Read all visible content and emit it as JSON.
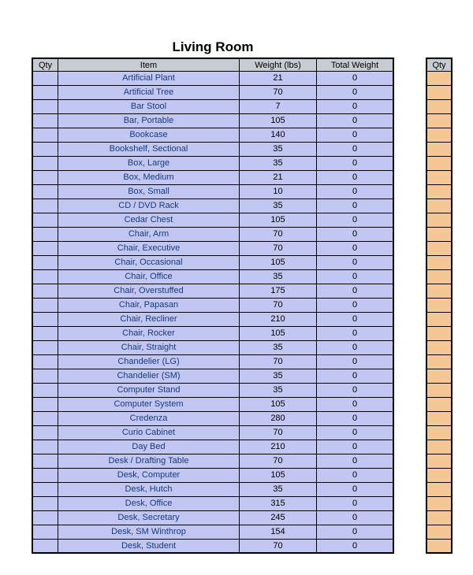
{
  "title": "Living Room",
  "headers": {
    "qty": "Qty",
    "item": "Item",
    "weight": "Weight (lbs)",
    "total": "Total Weight",
    "qty2": "Qty"
  },
  "rows": [
    {
      "qty": "",
      "item": "Artificial Plant",
      "weight": 21,
      "total": 0
    },
    {
      "qty": "",
      "item": "Artificial Tree",
      "weight": 70,
      "total": 0
    },
    {
      "qty": "",
      "item": "Bar Stool",
      "weight": 7,
      "total": 0
    },
    {
      "qty": "",
      "item": "Bar, Portable",
      "weight": 105,
      "total": 0
    },
    {
      "qty": "",
      "item": "Bookcase",
      "weight": 140,
      "total": 0
    },
    {
      "qty": "",
      "item": "Bookshelf, Sectional",
      "weight": 35,
      "total": 0
    },
    {
      "qty": "",
      "item": "Box, Large",
      "weight": 35,
      "total": 0
    },
    {
      "qty": "",
      "item": "Box, Medium",
      "weight": 21,
      "total": 0
    },
    {
      "qty": "",
      "item": "Box, Small",
      "weight": 10,
      "total": 0
    },
    {
      "qty": "",
      "item": "CD / DVD Rack",
      "weight": 35,
      "total": 0
    },
    {
      "qty": "",
      "item": "Cedar Chest",
      "weight": 105,
      "total": 0
    },
    {
      "qty": "",
      "item": "Chair, Arm",
      "weight": 70,
      "total": 0
    },
    {
      "qty": "",
      "item": "Chair, Executive",
      "weight": 70,
      "total": 0
    },
    {
      "qty": "",
      "item": "Chair, Occasional",
      "weight": 105,
      "total": 0
    },
    {
      "qty": "",
      "item": "Chair, Office",
      "weight": 35,
      "total": 0
    },
    {
      "qty": "",
      "item": "Chair, Overstuffed",
      "weight": 175,
      "total": 0
    },
    {
      "qty": "",
      "item": "Chair, Papasan",
      "weight": 70,
      "total": 0
    },
    {
      "qty": "",
      "item": "Chair, Recliner",
      "weight": 210,
      "total": 0
    },
    {
      "qty": "",
      "item": "Chair, Rocker",
      "weight": 105,
      "total": 0
    },
    {
      "qty": "",
      "item": "Chair, Straight",
      "weight": 35,
      "total": 0
    },
    {
      "qty": "",
      "item": "Chandelier (LG)",
      "weight": 70,
      "total": 0
    },
    {
      "qty": "",
      "item": "Chandelier (SM)",
      "weight": 35,
      "total": 0
    },
    {
      "qty": "",
      "item": "Computer Stand",
      "weight": 35,
      "total": 0
    },
    {
      "qty": "",
      "item": "Computer System",
      "weight": 105,
      "total": 0
    },
    {
      "qty": "",
      "item": "Credenza",
      "weight": 280,
      "total": 0
    },
    {
      "qty": "",
      "item": "Curio Cabinet",
      "weight": 70,
      "total": 0
    },
    {
      "qty": "",
      "item": "Day Bed",
      "weight": 210,
      "total": 0
    },
    {
      "qty": "",
      "item": "Desk / Drafting Table",
      "weight": 70,
      "total": 0
    },
    {
      "qty": "",
      "item": "Desk, Computer",
      "weight": 105,
      "total": 0
    },
    {
      "qty": "",
      "item": "Desk, Hutch",
      "weight": 35,
      "total": 0
    },
    {
      "qty": "",
      "item": "Desk, Office",
      "weight": 315,
      "total": 0
    },
    {
      "qty": "",
      "item": "Desk, Secretary",
      "weight": 245,
      "total": 0
    },
    {
      "qty": "",
      "item": "Desk, SM Winthrop",
      "weight": 154,
      "total": 0
    },
    {
      "qty": "",
      "item": "Desk, Student",
      "weight": 70,
      "total": 0
    }
  ]
}
